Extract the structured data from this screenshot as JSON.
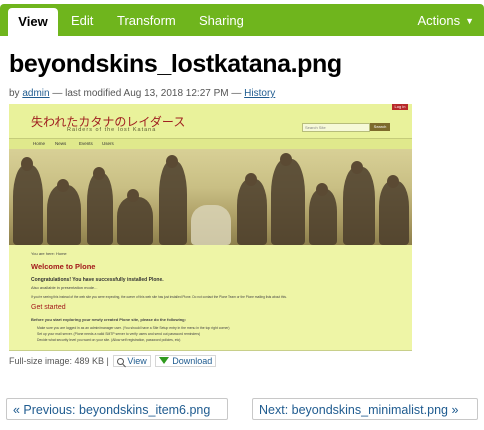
{
  "editbar": {
    "tabs": [
      {
        "label": "View",
        "active": true
      },
      {
        "label": "Edit",
        "active": false
      },
      {
        "label": "Transform",
        "active": false
      },
      {
        "label": "Sharing",
        "active": false
      }
    ],
    "actions_label": "Actions",
    "colors": {
      "bar": "#6fb51d",
      "active_tab_bg": "#ffffff"
    }
  },
  "page": {
    "title": "beyondskins_lostkatana.png",
    "byline": {
      "by": "by",
      "author": "admin",
      "modified_text": "— last modified Aug 13, 2018 12:27 PM —",
      "history": "History"
    }
  },
  "preview": {
    "site_name_jp": "失われたカタナのレイダース",
    "site_name_en": "Raiders of the lost Katana",
    "login": "Log in",
    "search_placeholder": "Search Site",
    "search_button": "Search",
    "nav": [
      "Home",
      "News",
      "Events",
      "Users"
    ],
    "breadcrumb": "You are here: Home",
    "welcome": "Welcome to Plone",
    "congrats": "Congratulations! You have successfully installed Plone.",
    "presentation": "Also available in presentation mode...",
    "notice": "If you're seeing this instead of the web site you were expecting, the owner of this web site has just installed Plone. Do not contact the Plone Team or the Plone mailing lists about this.",
    "get_started": "Get started",
    "before": "Before you start exploring your newly created Plone site, please do the following:",
    "steps": [
      "Make sure you are logged in as an admin/manager user. (You should have a Site Setup entry in the menu in the top right corner)",
      "Set up your mail server. (Plone needs a valid SMTP server to verify users and send out password reminders)",
      "Decide what security level you want on your site. (Allow self registration, password policies, etc)"
    ],
    "colors": {
      "bg": "#eef5a6",
      "accent_red": "#a3191b"
    }
  },
  "fullsize": {
    "label": "Full-size image: 489 KB |",
    "view": "View",
    "download": "Download"
  },
  "pager": {
    "previous": "« Previous: beyondskins_item6.png",
    "next": "Next: beyondskins_minimalist.png »"
  }
}
